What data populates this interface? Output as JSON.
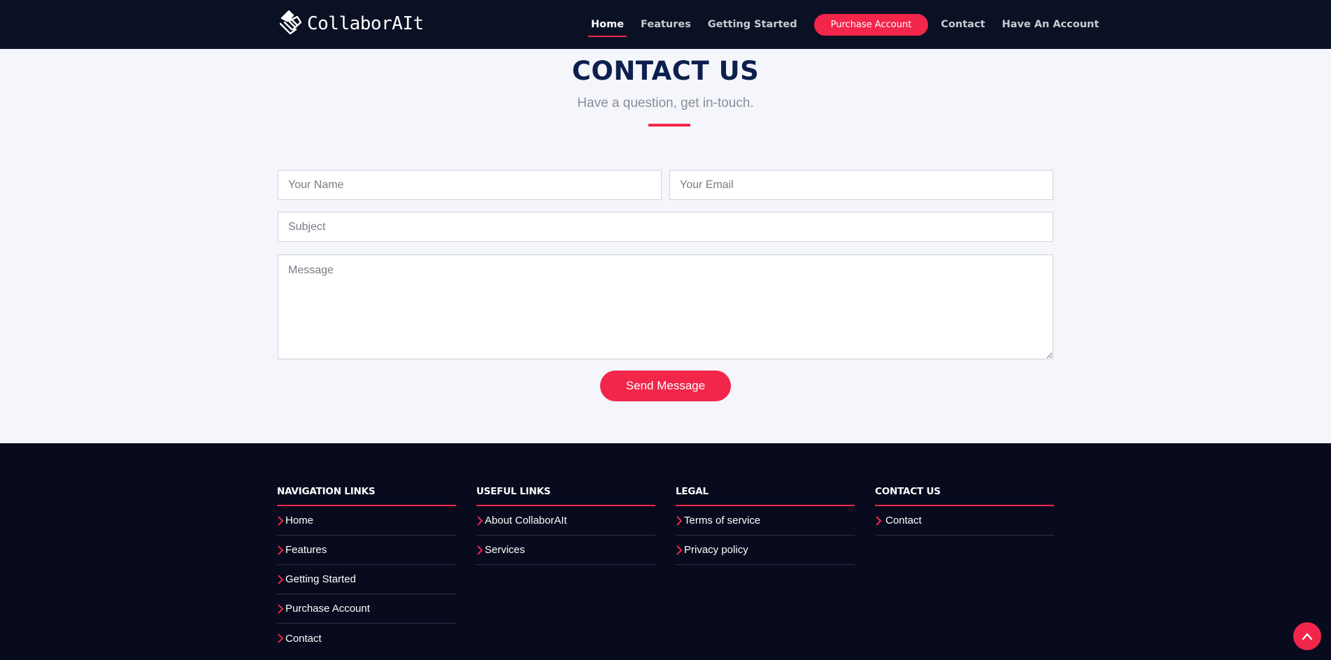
{
  "header": {
    "brand": "CollaborAIt",
    "nav": [
      {
        "label": "Home",
        "active": true
      },
      {
        "label": "Features",
        "active": false
      },
      {
        "label": "Getting Started",
        "active": false
      }
    ],
    "cta_label": "Purchase Account",
    "nav_after": [
      {
        "label": "Contact"
      },
      {
        "label": "Have An Account"
      }
    ]
  },
  "contact": {
    "title": "CONTACT US",
    "subtitle": "Have a question, get in-touch.",
    "name_placeholder": "Your Name",
    "email_placeholder": "Your Email",
    "subject_placeholder": "Subject",
    "message_placeholder": "Message",
    "send_label": "Send Message"
  },
  "footer": {
    "columns": [
      {
        "title": "NAVIGATION LINKS",
        "links": [
          "Home",
          "Features",
          "Getting Started",
          "Purchase Account",
          "Contact"
        ]
      },
      {
        "title": "USEFUL LINKS",
        "links": [
          "About CollaborAIt",
          "Services"
        ]
      },
      {
        "title": "LEGAL",
        "links": [
          "Terms of service",
          "Privacy policy"
        ]
      },
      {
        "title": "CONTACT US",
        "links": [
          "Contact"
        ]
      }
    ]
  },
  "colors": {
    "accent": "#f2254a",
    "header_bg": "#0b1124",
    "footer_bg": "#070b1d",
    "title": "#0c1f4e"
  },
  "icons": {
    "logo": "handshake-icon",
    "link_bullet": "chevron-right-icon",
    "back_to_top": "chevron-up-icon"
  }
}
